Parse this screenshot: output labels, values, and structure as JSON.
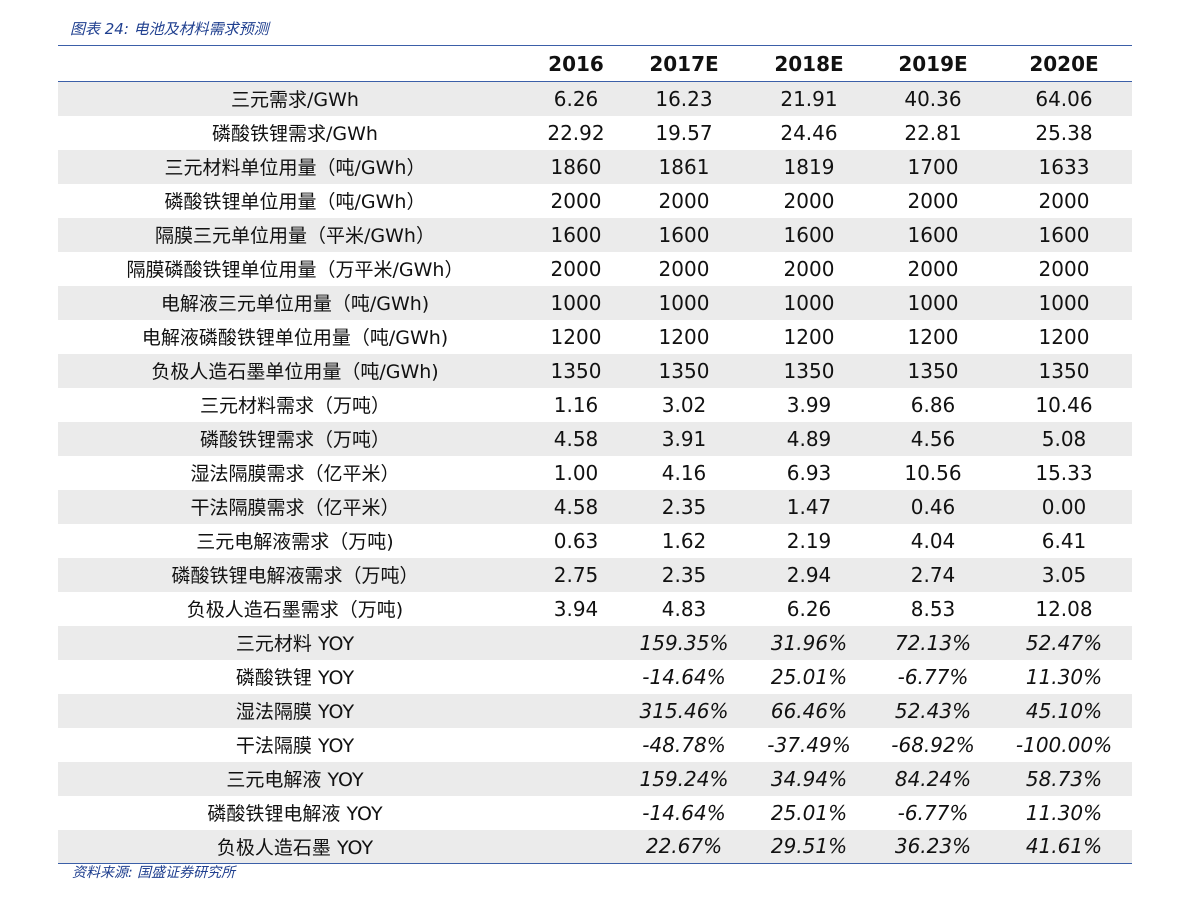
{
  "caption": "图表 24:  电池及材料需求预测",
  "source": "资料来源:  国盛证券研究所",
  "table": {
    "headers": [
      "",
      "2016",
      "2017E",
      "2018E",
      "2019E",
      "2020E"
    ],
    "rows": [
      {
        "label": "三元需求/GWh",
        "values": [
          "6.26",
          "16.23",
          "21.91",
          "40.36",
          "64.06"
        ]
      },
      {
        "label": "磷酸铁锂需求/GWh",
        "values": [
          "22.92",
          "19.57",
          "24.46",
          "22.81",
          "25.38"
        ]
      },
      {
        "label": "三元材料单位用量（吨/GWh）",
        "values": [
          "1860",
          "1861",
          "1819",
          "1700",
          "1633"
        ]
      },
      {
        "label": "磷酸铁锂单位用量（吨/GWh）",
        "values": [
          "2000",
          "2000",
          "2000",
          "2000",
          "2000"
        ]
      },
      {
        "label": "隔膜三元单位用量（平米/GWh）",
        "values": [
          "1600",
          "1600",
          "1600",
          "1600",
          "1600"
        ]
      },
      {
        "label": "隔膜磷酸铁锂单位用量（万平米/GWh）",
        "values": [
          "2000",
          "2000",
          "2000",
          "2000",
          "2000"
        ]
      },
      {
        "label": "电解液三元单位用量（吨/GWh)",
        "values": [
          "1000",
          "1000",
          "1000",
          "1000",
          "1000"
        ]
      },
      {
        "label": "电解液磷酸铁锂单位用量（吨/GWh)",
        "values": [
          "1200",
          "1200",
          "1200",
          "1200",
          "1200"
        ]
      },
      {
        "label": "负极人造石墨单位用量（吨/GWh)",
        "values": [
          "1350",
          "1350",
          "1350",
          "1350",
          "1350"
        ]
      },
      {
        "label": "三元材料需求（万吨）",
        "values": [
          "1.16",
          "3.02",
          "3.99",
          "6.86",
          "10.46"
        ]
      },
      {
        "label": "磷酸铁锂需求（万吨）",
        "values": [
          "4.58",
          "3.91",
          "4.89",
          "4.56",
          "5.08"
        ]
      },
      {
        "label": "湿法隔膜需求（亿平米）",
        "values": [
          "1.00",
          "4.16",
          "6.93",
          "10.56",
          "15.33"
        ]
      },
      {
        "label": "干法隔膜需求（亿平米）",
        "values": [
          "4.58",
          "2.35",
          "1.47",
          "0.46",
          "0.00"
        ]
      },
      {
        "label": "三元电解液需求（万吨)",
        "values": [
          "0.63",
          "1.62",
          "2.19",
          "4.04",
          "6.41"
        ]
      },
      {
        "label": "磷酸铁锂电解液需求（万吨）",
        "values": [
          "2.75",
          "2.35",
          "2.94",
          "2.74",
          "3.05"
        ]
      },
      {
        "label": "负极人造石墨需求（万吨)",
        "values": [
          "3.94",
          "4.83",
          "6.26",
          "8.53",
          "12.08"
        ]
      },
      {
        "label": "三元材料 YOY",
        "values": [
          "",
          "159.35%",
          "31.96%",
          "72.13%",
          "52.47%"
        ],
        "yoy": true
      },
      {
        "label": "磷酸铁锂 YOY",
        "values": [
          "",
          "-14.64%",
          "25.01%",
          "-6.77%",
          "11.30%"
        ],
        "yoy": true
      },
      {
        "label": "湿法隔膜 YOY",
        "values": [
          "",
          "315.46%",
          "66.46%",
          "52.43%",
          "45.10%"
        ],
        "yoy": true
      },
      {
        "label": "干法隔膜 YOY",
        "values": [
          "",
          "-48.78%",
          "-37.49%",
          "-68.92%",
          "-100.00%"
        ],
        "yoy": true
      },
      {
        "label": "三元电解液 YOY",
        "values": [
          "",
          "159.24%",
          "34.94%",
          "84.24%",
          "58.73%"
        ],
        "yoy": true
      },
      {
        "label": "磷酸铁锂电解液 YOY",
        "values": [
          "",
          "-14.64%",
          "25.01%",
          "-6.77%",
          "11.30%"
        ],
        "yoy": true
      },
      {
        "label": "负极人造石墨 YOY",
        "values": [
          "",
          "22.67%",
          "29.51%",
          "36.23%",
          "41.61%"
        ],
        "yoy": true
      }
    ]
  },
  "colors": {
    "caption_text": "#1f3f8f",
    "rule_line": "#3b5fa8",
    "alt_row_bg": "#ebebeb"
  }
}
